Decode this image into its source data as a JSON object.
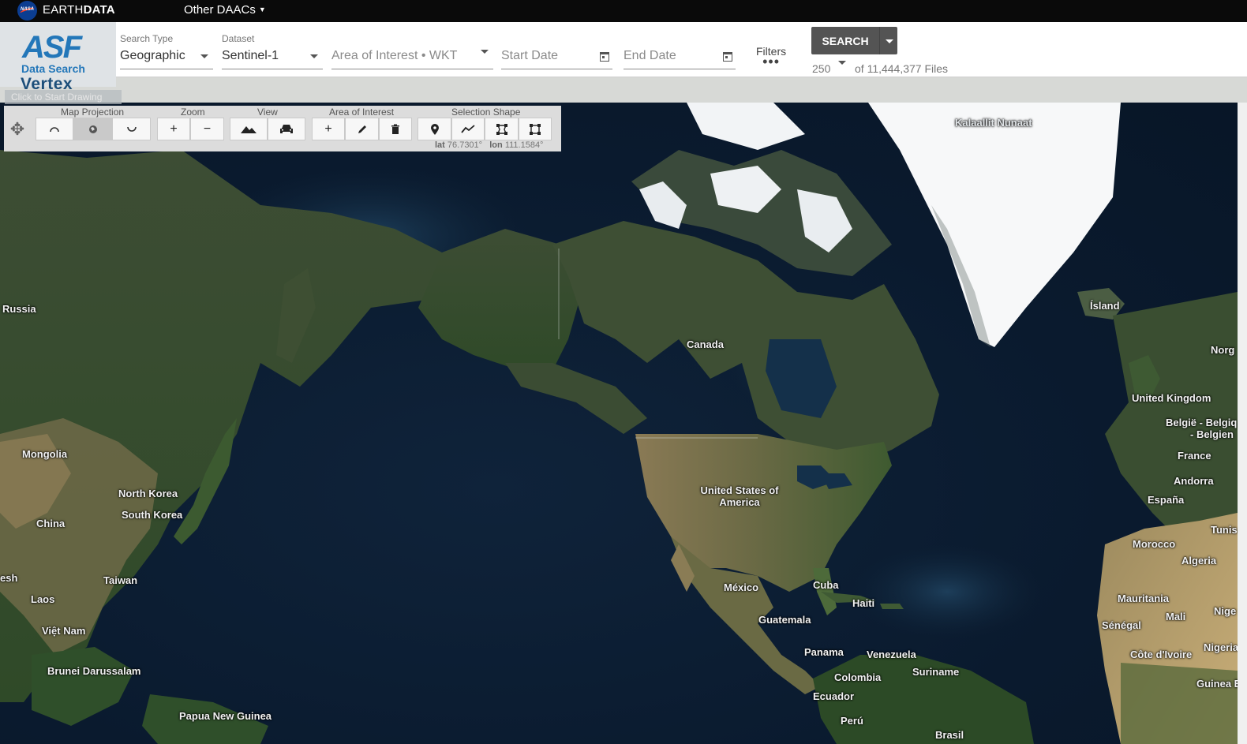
{
  "topbar": {
    "nasa_logo": "NASA",
    "brand_a": "EARTH",
    "brand_b": "DATA",
    "other_daacs": "Other DAACs"
  },
  "logo": {
    "mark": "ASF",
    "sub": "Data Search",
    "name": "Vertex"
  },
  "search": {
    "search_type_label": "Search Type",
    "search_type_value": "Geographic",
    "dataset_label": "Dataset",
    "dataset_value": "Sentinel-1",
    "aoi_placeholder": "Area of Interest • WKT",
    "start_date_placeholder": "Start Date",
    "end_date_placeholder": "End Date",
    "filters_label": "Filters",
    "filters_dots": "•••",
    "search_button": "SEARCH",
    "max_results": "250",
    "file_count": "of 11,444,377 Files"
  },
  "hint": "Click to Start Drawing",
  "toolbar": {
    "groups": {
      "projection": "Map Projection",
      "zoom": "Zoom",
      "view": "View",
      "aoi": "Area of Interest",
      "shape": "Selection Shape"
    },
    "zoom_in": "+",
    "zoom_out": "−",
    "aoi_add": "+",
    "coords_lat_label": "lat",
    "coords_lat": "76.7301°",
    "coords_lon_label": "lon",
    "coords_lon": "111.1584°"
  },
  "map_labels": {
    "kalaallit": "Kalaallit Nunaat",
    "russia": "Russia",
    "island": "Ísland",
    "norge": "Norg",
    "canada": "Canada",
    "uk": "United Kingdom",
    "belgie": "België - Belgiq",
    "belgien": "- Belgien",
    "france": "France",
    "mongolia": "Mongolia",
    "andorra": "Andorra",
    "espana": "España",
    "tunis": "Tunis",
    "north_korea": "North Korea",
    "usa": "United States of America",
    "south_korea": "South Korea",
    "china": "China",
    "morocco": "Morocco",
    "algeria": "Algeria",
    "taiwan": "Taiwan",
    "esh": "esh",
    "mexico": "México",
    "cuba": "Cuba",
    "mauritania": "Mauritania",
    "laos": "Laos",
    "haiti": "Haiti",
    "mali": "Mali",
    "nige": "Nige",
    "guatemala": "Guatemala",
    "senegal": "Sénégal",
    "vietnam": "Việt Nam",
    "panama": "Panama",
    "venezuela": "Venezuela",
    "cote": "Côte d'Ivoire",
    "nigeria": "Nigeria",
    "brunei": "Brunei Darussalam",
    "suriname": "Suriname",
    "colombia": "Colombia",
    "guinea_eq": "Guinea Ec",
    "ecuador": "Ecuador",
    "png": "Papua New Guinea",
    "peru": "Perú",
    "brasil": "Brasil"
  }
}
